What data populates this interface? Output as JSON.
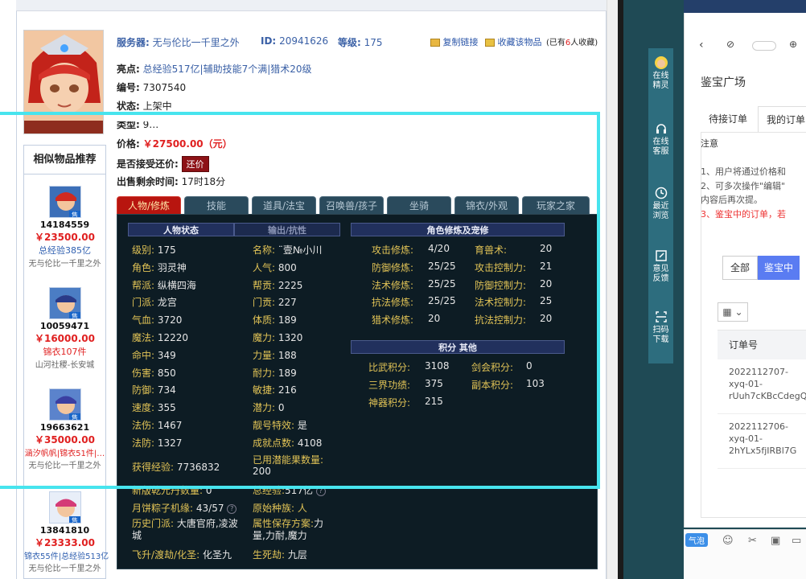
{
  "top": {
    "server_label": "服务器:",
    "server_value": "无与伦比一千里之外",
    "id_label": "ID:",
    "id_value": "20941626",
    "level_label": "等级:",
    "level_value": "175",
    "copy_link": "复制链接",
    "favorite": "收藏该物品",
    "fav_count_prefix": "(已有",
    "fav_count": "6",
    "fav_count_suffix": "人收藏)"
  },
  "item": {
    "highlight_label": "亮点:",
    "highlight_value": "总经验517亿|辅助技能7个满|猎术20级",
    "number_label": "编号:",
    "number_value": "7307540",
    "status_label": "状态:",
    "status_value": "上架中",
    "type_label": "类型:",
    "type_value": "9…",
    "price_label": "价格:",
    "price_value": "￥27500.00（元）",
    "bargain_label": "是否接受还价:",
    "bargain_button": "还价",
    "remaining_label": "出售剩余时间:",
    "remaining_value": "17时18分"
  },
  "related": {
    "title": "相似物品推荐",
    "items": [
      {
        "id": "14184559",
        "price": "￥23500.00",
        "desc": "总经验385亿",
        "server": "无与伦比一千里之外"
      },
      {
        "id": "10059471",
        "price": "￥16000.00",
        "desc": "锦衣107件",
        "server": "山河社稷-长安城"
      },
      {
        "id": "19663621",
        "price": "￥35000.00",
        "desc": "涵汐帆帆|锦衣51件|…",
        "server": "无与伦比一千里之外"
      },
      {
        "id": "13841810",
        "price": "￥23333.00",
        "desc": "锦衣55件|总经验513亿",
        "server": "无与伦比一千里之外"
      }
    ]
  },
  "tabs": [
    "人物/修炼",
    "技能",
    "道具/法宝",
    "召唤兽/孩子",
    "坐骑",
    "锦衣/外观",
    "玩家之家"
  ],
  "panel": {
    "sub_tab_active": "人物状态",
    "sub_tab_inactive": "输出/抗性",
    "left_rows": [
      {
        "k": "级别:",
        "v": "175",
        "k2": "名称:",
        "v2": "¨壹№小川"
      },
      {
        "k": "角色:",
        "v": "羽灵神",
        "k2": "人气:",
        "v2": "800"
      },
      {
        "k": "帮派:",
        "v": "纵横四海",
        "k2": "帮贡:",
        "v2": "2225"
      },
      {
        "k": "门派:",
        "v": "龙宫",
        "k2": "门贡:",
        "v2": "227"
      },
      {
        "k": "气血:",
        "v": "3720",
        "k2": "体质:",
        "v2": "189"
      },
      {
        "k": "魔法:",
        "v": "12220",
        "k2": "魔力:",
        "v2": "1320"
      },
      {
        "k": "命中:",
        "v": "349",
        "k2": "力量:",
        "v2": "188"
      },
      {
        "k": "伤害:",
        "v": "850",
        "k2": "耐力:",
        "v2": "189"
      },
      {
        "k": "防御:",
        "v": "734",
        "k2": "敏捷:",
        "v2": "216"
      },
      {
        "k": "速度:",
        "v": "355",
        "k2": "潜力:",
        "v2": "0"
      },
      {
        "k": "法伤:",
        "v": "1467",
        "k2": "靓号特效:",
        "v2": "是"
      },
      {
        "k": "法防:",
        "v": "1327",
        "k2": "成就点数:",
        "v2": "4108"
      }
    ],
    "exp_label": "获得经验:",
    "exp_value": "7736832",
    "potential_label": "已用潜能果数量:",
    "potential_value": "200",
    "new_label": "新版乾元丹数量:",
    "new_value": "0",
    "total_exp_label": "总经验:",
    "total_exp_value": "517亿",
    "moon_label": "月饼粽子机缘:",
    "moon_value": "43/57",
    "race_label": "原始种族:",
    "race_value": "人",
    "history_label": "历史门派:",
    "history_value": "大唐官府,凌波城",
    "attr_label": "属性保存方案:",
    "attr_value": "力量,力耐,魔力",
    "ascend_label": "飞升/渡劫/化圣:",
    "ascend_value": "化圣九",
    "life_label": "生死劫:",
    "life_value": "九层",
    "cultivation_title": "角色修炼及宠修",
    "cultivation_rows": [
      {
        "k": "攻击修炼:",
        "v": "4/20",
        "k2": "育兽术:",
        "v2": "20"
      },
      {
        "k": "防御修炼:",
        "v": "25/25",
        "k2": "攻击控制力:",
        "v2": "21"
      },
      {
        "k": "法术修炼:",
        "v": "25/25",
        "k2": "防御控制力:",
        "v2": "20"
      },
      {
        "k": "抗法修炼:",
        "v": "25/25",
        "k2": "法术控制力:",
        "v2": "25"
      },
      {
        "k": "猎术修炼:",
        "v": "20",
        "k2": "抗法控制力:",
        "v2": "20"
      }
    ],
    "score_title": "积分 其他",
    "score_rows": [
      {
        "k": "比武积分:",
        "v": "3108",
        "k2": "剑会积分:",
        "v2": "0"
      },
      {
        "k": "三界功绩:",
        "v": "375",
        "k2": "副本积分:",
        "v2": "103"
      },
      {
        "k": "神器积分:",
        "v": "215",
        "k2": "",
        "v2": ""
      }
    ]
  },
  "sidebar": {
    "items": [
      "在线精灵",
      "在线客服",
      "最近浏览",
      "意见反馈",
      "扫码下载"
    ]
  },
  "mini": {
    "title": "鉴宝广场",
    "tab1": "待接订单",
    "tab2": "我的订单",
    "note_title": "注意",
    "note1": "1、用户将通过价格和",
    "note2": "2、可多次操作\"编辑\"",
    "note3": "内容后再次提。",
    "note4": "3、鉴宝中的订单，若",
    "btn_all": "全部",
    "btn_selected": "鉴宝中",
    "table_header": "订单号",
    "orders": [
      "2022112707-xyq-01-rUuh7cKBcCdegQ",
      "2022112706-xyq-01-2hYLx5fjIRBl7G"
    ],
    "bottom_tag": "气泡"
  }
}
